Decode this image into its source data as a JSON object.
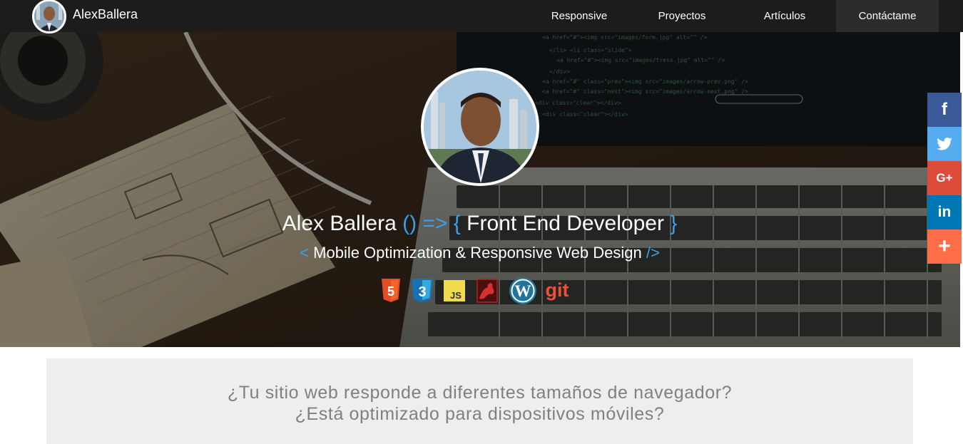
{
  "navbar": {
    "brand": "AlexBallera",
    "links": [
      {
        "label": "Responsive"
      },
      {
        "label": "Proyectos"
      },
      {
        "label": "Artículos"
      },
      {
        "label": "Contáctame"
      }
    ],
    "active_index": 3,
    "colors": {
      "background": "#1c1c1c",
      "active": "#2c2c2c"
    }
  },
  "hero": {
    "title_name": "Alex Ballera",
    "title_arrow": " () => { ",
    "title_role": "Front End Developer",
    "title_close": " }",
    "subtitle_open": "< ",
    "subtitle_text": "Mobile Optimization & Responsive Web Design",
    "subtitle_close": " />",
    "accent_color": "#3aa0ea",
    "tech_icons": [
      {
        "icon": "html5-icon",
        "color": "#e44d26",
        "label": "5"
      },
      {
        "icon": "css3-icon",
        "color": "#1572b6",
        "label": "3"
      },
      {
        "icon": "javascript-icon",
        "color": "#f0db4f",
        "label": "JS"
      },
      {
        "icon": "sass-bird-icon",
        "color": "#cc2222"
      },
      {
        "icon": "wordpress-icon",
        "color": "#21759b",
        "label": "W"
      },
      {
        "icon": "git-icon",
        "color": "#f05032",
        "label": "git"
      }
    ]
  },
  "social": {
    "buttons": [
      {
        "icon": "facebook-icon",
        "label": "f",
        "color": "#3b5998"
      },
      {
        "icon": "twitter-icon",
        "color": "#55acee"
      },
      {
        "icon": "google-plus-icon",
        "label": "G+",
        "color": "#dd4b39"
      },
      {
        "icon": "linkedin-icon",
        "label": "in",
        "color": "#0077b5"
      },
      {
        "icon": "more-icon",
        "label": "+",
        "color": "#ff6e48"
      }
    ]
  },
  "intro": {
    "line1": "¿Tu sitio web responde a diferentes tamaños de navegador?",
    "line2": "¿Está optimizado para dispositivos móviles?",
    "background": "#eeeeee"
  }
}
